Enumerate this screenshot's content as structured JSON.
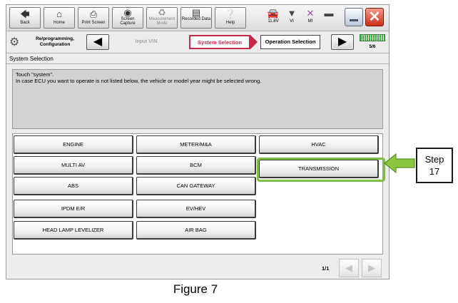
{
  "toolbar": {
    "buttons": [
      {
        "label": "Back",
        "icon": "back-arrow-icon"
      },
      {
        "label": "Home",
        "icon": "home-icon"
      },
      {
        "label": "Print Screen",
        "icon": "printer-icon"
      },
      {
        "label": "Screen Capture",
        "icon": "camera-icon"
      },
      {
        "label": "Measurement Mode",
        "icon": "measurement-icon"
      },
      {
        "label": "Recorded Data",
        "icon": "recorded-data-icon"
      },
      {
        "label": "Help",
        "icon": "help-icon"
      }
    ],
    "status": {
      "voltage": "11.8V",
      "vi_label": "VI",
      "mi_label": "MI"
    }
  },
  "breadcrumb": {
    "reprog_label": "Re/programming, Configuration",
    "steps": [
      "Input VIN",
      "System Selection",
      "Operation Selection"
    ],
    "page": "5/6"
  },
  "screen_title": "System Selection",
  "message": {
    "line1": "Touch \"system\".",
    "line2": "In case ECU you want to operate is not listed below, the vehicle or model year might be selected wrong."
  },
  "systems": [
    [
      "ENGINE",
      "METER/M&A",
      "HVAC"
    ],
    [
      "MULTI AV",
      "BCM",
      "TRANSMISSION"
    ],
    [
      "ABS",
      "CAN GATEWAY"
    ],
    [
      "IPDM E/R",
      "EV/HEV"
    ],
    [
      "HEAD LAMP LEVELIZER",
      "AIR BAG"
    ]
  ],
  "pager": {
    "text": "1/1"
  },
  "callout": {
    "line1": "Step",
    "line2": "17"
  },
  "caption": "Figure 7",
  "colors": {
    "highlight": "#7cc242",
    "active_crumb": "#c8284a"
  }
}
